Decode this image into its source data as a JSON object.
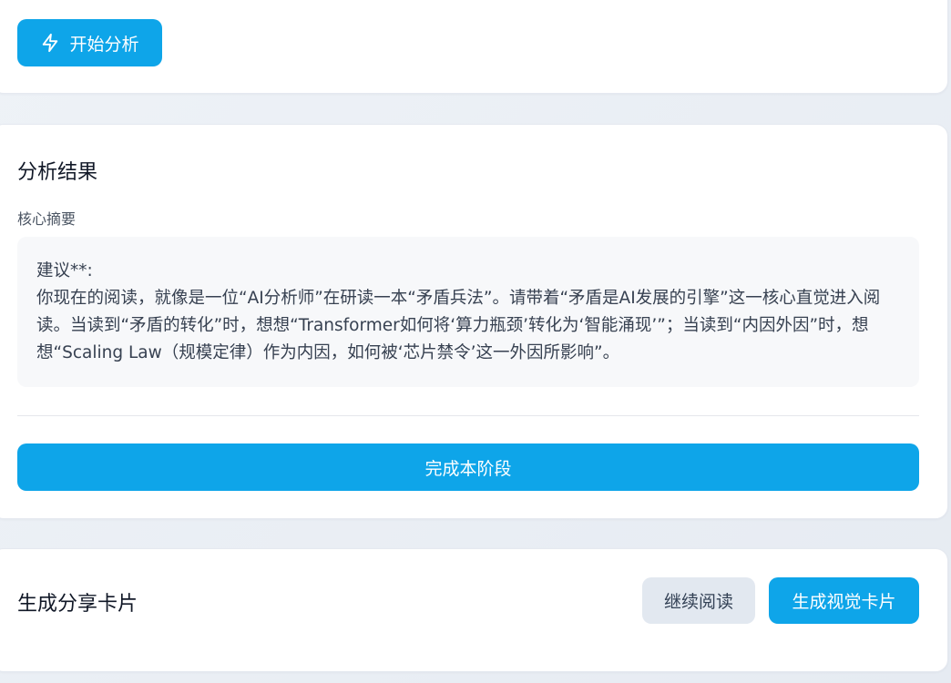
{
  "analyze": {
    "start_label": "开始分析",
    "start_icon": "lightning-icon"
  },
  "result": {
    "title": "分析结果",
    "summary_label": "核心摘要",
    "summary_text": "建议**:\n你现在的阅读，就像是一位“AI分析师”在研读一本“矛盾兵法”。请带着“矛盾是AI发展的引擎”这一核心直觉进入阅读。当读到“矛盾的转化”时，想想“Transformer如何将‘算力瓶颈’转化为‘智能涌现’”；当读到“内因外因”时，想想“Scaling Law（规模定律）作为内因，如何被‘芯片禁令’这一外因所影响”。",
    "complete_label": "完成本阶段"
  },
  "share": {
    "title": "生成分享卡片",
    "continue_label": "继续阅读",
    "visual_card_label": "生成视觉卡片"
  },
  "colors": {
    "accent": "#0ea5e9",
    "secondary_button": "#e2e8f0",
    "background": "#eef2f7"
  }
}
